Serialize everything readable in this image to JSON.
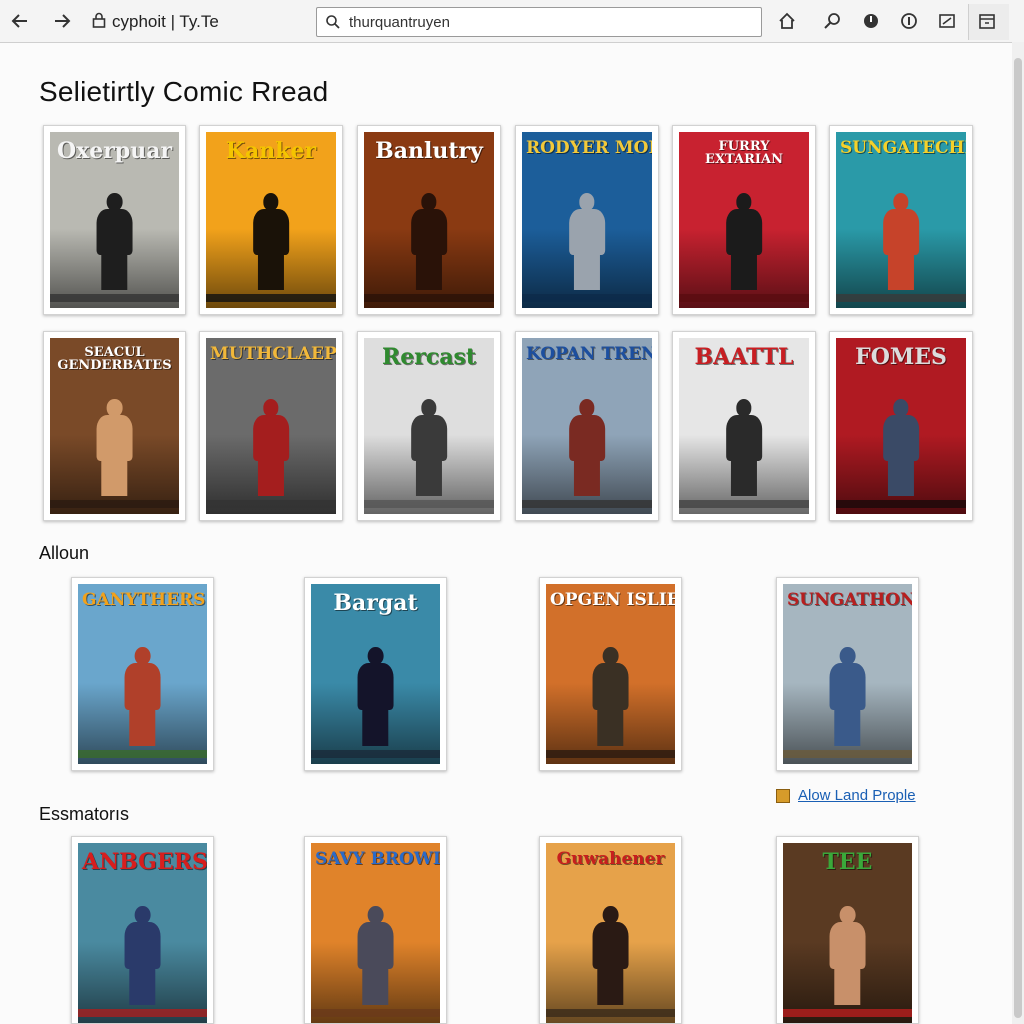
{
  "browser": {
    "site_label": "cyphoit | Ty.Te",
    "url": "thurquantruyen"
  },
  "page": {
    "title": "Selietirtly Comic Rread",
    "section_1": "Alloun",
    "section_2": "Essmatorıs",
    "link": "Alow Land Prople"
  },
  "rows": {
    "row1": [
      {
        "title": "Oxerpuar",
        "bg": "#b9b9b2",
        "fg": "#1e1e1e",
        "tc": "#f5f5f5",
        "strip": "#333333"
      },
      {
        "title": "Kanker",
        "bg": "#f2a21b",
        "fg": "#1a1208",
        "tc": "#f5c400",
        "strip": "#111111"
      },
      {
        "title": "Banlutry",
        "bg": "#8a3a12",
        "fg": "#2a1208",
        "tc": "#ffffff",
        "strip": "#2a1208"
      },
      {
        "title": "RODYER MOLN",
        "bg": "#1c5e9a",
        "fg": "#9aa3ad",
        "tc": "#f2c93a",
        "strip": "#0c2a4a"
      },
      {
        "title": "FURRY EXTARIAN",
        "bg": "#c82230",
        "fg": "#1b1b1b",
        "tc": "#ffffff",
        "strip": "#5a0c10"
      },
      {
        "title": "SUNGATECHE",
        "bg": "#2a9aa8",
        "fg": "#c6432a",
        "tc": "#f5d12a",
        "strip": "#3a3a3a"
      }
    ],
    "row2": [
      {
        "title": "SEACUL GENDERBATES",
        "bg": "#7a4a28",
        "fg": "#d19a6a",
        "tc": "#ffffff",
        "strip": "#2a1a10"
      },
      {
        "title": "MUTHCLAEP",
        "bg": "#6b6b6b",
        "fg": "#a41e1e",
        "tc": "#f2b83a",
        "strip": "#333333"
      },
      {
        "title": "Rercast",
        "bg": "#dedede",
        "fg": "#3a3a3a",
        "tc": "#2f8a2f",
        "strip": "#555555"
      },
      {
        "title": "KOPAN TRENTE",
        "bg": "#8fa4b8",
        "fg": "#7a2a22",
        "tc": "#1c4fa0",
        "strip": "#333333"
      },
      {
        "title": "BAATTL",
        "bg": "#e6e6e6",
        "fg": "#2a2a2a",
        "tc": "#c81e22",
        "strip": "#444444"
      },
      {
        "title": "FOMES",
        "bg": "#b01a22",
        "fg": "#3a4a66",
        "tc": "#dcdcdc",
        "strip": "#1a0a0a"
      }
    ],
    "row3": [
      {
        "title": "GANYTHERS",
        "bg": "#6aa6cc",
        "fg": "#b0402a",
        "tc": "#f2a21b",
        "strip": "#3a6a2a"
      },
      {
        "title": "Bargat",
        "bg": "#3a8aa8",
        "fg": "#14142a",
        "tc": "#ffffff",
        "strip": "#1a2a3a"
      },
      {
        "title": "OPGEN ISLIEN",
        "bg": "#d2702a",
        "fg": "#3a3024",
        "tc": "#ffffff",
        "strip": "#2a1a10"
      },
      {
        "title": "SUNGATHONE",
        "bg": "#a6b6c0",
        "fg": "#3a5a8a",
        "tc": "#b81e1e",
        "strip": "#6a5a3a"
      }
    ],
    "row4": [
      {
        "title": "ANBGERS",
        "bg": "#4a8aa0",
        "fg": "#2a3a6a",
        "tc": "#d81e1e",
        "strip": "#a81e1e"
      },
      {
        "title": "SAVY BROWITS",
        "bg": "#e0832a",
        "fg": "#4a4a5a",
        "tc": "#2a6ac8",
        "strip": "#6a3a1a"
      },
      {
        "title": "Guwahener",
        "bg": "#e6a24a",
        "fg": "#2a1a14",
        "tc": "#c81e1e",
        "strip": "#3a2a1a"
      },
      {
        "title": "TEE",
        "bg": "#5a3a22",
        "fg": "#c8906a",
        "tc": "#3aa83a",
        "strip": "#b81e1e"
      }
    ]
  }
}
